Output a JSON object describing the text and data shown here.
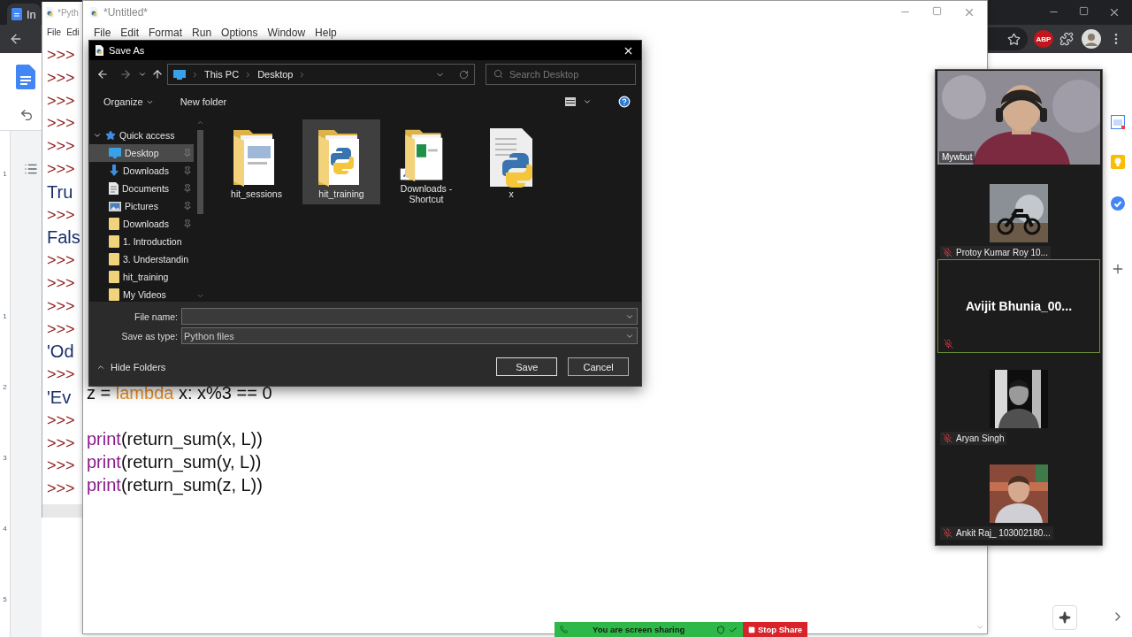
{
  "browser": {
    "tab_title": "In",
    "extension_label": "ABP",
    "ruler_marks": [
      "1",
      "1",
      "2",
      "3",
      "4",
      "5"
    ]
  },
  "shell_window": {
    "title": "*Pyth",
    "menu": [
      "File",
      "Edi"
    ],
    "lines": [
      {
        "kind": "prompt",
        "text": ">>>"
      },
      {
        "kind": "prompt",
        "text": ">>>"
      },
      {
        "kind": "prompt",
        "text": ">>>"
      },
      {
        "kind": "prompt",
        "text": ">>>"
      },
      {
        "kind": "prompt",
        "text": ">>>"
      },
      {
        "kind": "prompt",
        "text": ">>>"
      },
      {
        "kind": "output",
        "text": "Tru"
      },
      {
        "kind": "prompt",
        "text": ">>>"
      },
      {
        "kind": "output",
        "text": "Fals"
      },
      {
        "kind": "prompt",
        "text": ">>>"
      },
      {
        "kind": "prompt",
        "text": ">>>"
      },
      {
        "kind": "prompt",
        "text": ">>>"
      },
      {
        "kind": "prompt",
        "text": ">>>"
      },
      {
        "kind": "output",
        "text": "'Od"
      },
      {
        "kind": "prompt",
        "text": ">>>"
      },
      {
        "kind": "output",
        "text": "'Ev"
      },
      {
        "kind": "prompt",
        "text": ">>>"
      },
      {
        "kind": "prompt",
        "text": ">>>"
      },
      {
        "kind": "prompt",
        "text": ">>>"
      },
      {
        "kind": "prompt",
        "text": ">>>"
      }
    ]
  },
  "editor_window": {
    "title": "*Untitled*",
    "menu": [
      "File",
      "Edit",
      "Format",
      "Run",
      "Options",
      "Window",
      "Help"
    ],
    "code_blocks": [
      {
        "lines": [
          {
            "tokens": [
              {
                "kind": "plain",
                "text": "z = "
              },
              {
                "kind": "keyword",
                "text": "lambda"
              },
              {
                "kind": "plain",
                "text": " x: x%3 == 0"
              }
            ]
          }
        ]
      },
      {
        "lines": [
          {
            "tokens": [
              {
                "kind": "builtin",
                "text": "print"
              },
              {
                "kind": "plain",
                "text": "(return_sum(x, L))"
              }
            ]
          },
          {
            "tokens": [
              {
                "kind": "builtin",
                "text": "print"
              },
              {
                "kind": "plain",
                "text": "(return_sum(y, L))"
              }
            ]
          },
          {
            "tokens": [
              {
                "kind": "builtin",
                "text": "print"
              },
              {
                "kind": "plain",
                "text": "(return_sum(z, L))"
              }
            ]
          }
        ]
      }
    ]
  },
  "save_dialog": {
    "title": "Save As",
    "path": [
      "This PC",
      "Desktop"
    ],
    "search": {
      "placeholder": "Search Desktop"
    },
    "toolbar": [
      "Organize",
      "New folder"
    ],
    "nav": [
      {
        "label": "Quick access",
        "kind": "quick-access",
        "expanded": true,
        "selected": false,
        "children": [
          {
            "label": "Desktop",
            "kind": "desktop",
            "selected": true,
            "pinned": true
          },
          {
            "label": "Downloads",
            "kind": "downloads",
            "selected": false,
            "pinned": true
          },
          {
            "label": "Documents",
            "kind": "documents",
            "selected": false,
            "pinned": true
          },
          {
            "label": "Pictures",
            "kind": "pictures",
            "selected": false,
            "pinned": true
          },
          {
            "label": "Downloads",
            "kind": "folder",
            "selected": false,
            "pinned": true
          },
          {
            "label": "1. Introduction",
            "kind": "folder",
            "selected": false,
            "pinned": false
          },
          {
            "label": "3. Understandin",
            "kind": "folder",
            "selected": false,
            "pinned": false
          },
          {
            "label": "hit_training",
            "kind": "folder",
            "selected": false,
            "pinned": false
          },
          {
            "label": "My Videos",
            "kind": "folder",
            "selected": false,
            "pinned": false
          }
        ]
      }
    ],
    "files": [
      {
        "name": "hit_sessions",
        "kind": "folder-docs",
        "selected": false
      },
      {
        "name": "hit_training",
        "kind": "folder-python",
        "selected": true
      },
      {
        "name": "Downloads - Shortcut",
        "kind": "folder-shortcut",
        "selected": false
      },
      {
        "name": "x",
        "kind": "python-file",
        "selected": false
      }
    ],
    "file_name": {
      "label": "File name:"
    },
    "save_type": {
      "label": "Save as type:",
      "value": "Python files"
    },
    "hide_folders": "Hide Folders",
    "buttons": [
      "Save",
      "Cancel"
    ]
  },
  "meeting_panel": {
    "participants": [
      {
        "name": "Mywbut",
        "kind": "video",
        "muted": false,
        "active_speaker": false
      },
      {
        "name": "Protoy Kumar Roy 10...",
        "kind": "picture",
        "muted": true,
        "active_speaker": false
      },
      {
        "name": "Avijit Bhunia_00...",
        "kind": "name",
        "muted": true,
        "active_speaker": true
      },
      {
        "name": "Aryan Singh",
        "kind": "picture",
        "muted": true,
        "active_speaker": false
      },
      {
        "name": "Ankit Raj_ 103002180...",
        "kind": "picture",
        "muted": true,
        "active_speaker": false
      }
    ]
  },
  "share_bar": {
    "status": "You are screen sharing",
    "stop_label": "Stop Share"
  }
}
